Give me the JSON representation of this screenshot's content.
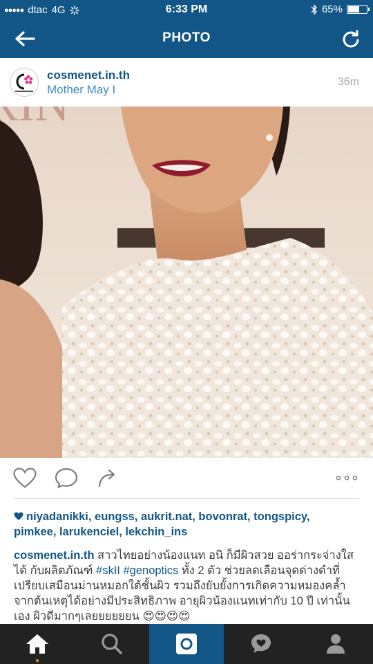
{
  "status_bar": {
    "carrier": "dtac",
    "network": "4G",
    "time": "6:33 PM",
    "battery": "65%",
    "battery_level": 0.65
  },
  "app_bar": {
    "title": "PHOTO",
    "back_icon": "arrow-left-icon",
    "refresh_icon": "refresh-icon"
  },
  "post": {
    "username": "cosmenet.in.th",
    "location": "Mother May I",
    "time_ago": "36m",
    "avatar_icon": "cosmenet-logo"
  },
  "actions": {
    "like_icon": "heart-outline-icon",
    "comment_icon": "comment-bubble-icon",
    "share_icon": "share-arrow-icon",
    "more_icon": "more-dots-icon"
  },
  "likes": {
    "line1": "niyadanikki, eungss, aukrit.nat, bovonrat, tongspicy,",
    "line2": "pimkee, larukenciel, lekchin_ins"
  },
  "caption": {
    "username": "cosmenet.in.th",
    "text_1": " สาวไทยอย่างน้องแนท อนิ  ก็มีผิวสวย ออร่ากระจ่างใสได้ กับผลิตภัณฑ์ ",
    "tag_1": "#skII",
    "space": " ",
    "tag_2": "#genoptics",
    "text_2": " ทั้ง 2 ตัว ช่วยลดเลือนจุดด่างดำที่เปรียบเสมือนม่านหมอกใต้ชั้นผิว รวมถึงยับยั้งการเกิดความหมองคล้ำจากต้นเหตุได้อย่างมีประสิทธิภาพ อายุผิวน้องแนทเท่ากับ 10 ปี เท่านั้นเอง ผิวดีมากๆเลยยยยยยน ",
    "emoji": "😍😍😍😍"
  },
  "tab_bar": {
    "tabs": [
      {
        "name": "home",
        "icon": "home-icon"
      },
      {
        "name": "search",
        "icon": "search-icon"
      },
      {
        "name": "camera",
        "icon": "camera-icon",
        "active": true
      },
      {
        "name": "activity",
        "icon": "activity-heart-bubble-icon"
      },
      {
        "name": "profile",
        "icon": "profile-icon"
      }
    ]
  },
  "colors": {
    "brand": "#125688",
    "link": "#3f89c6",
    "tabbar": "#222222",
    "notification_dot": "#f28a30"
  }
}
